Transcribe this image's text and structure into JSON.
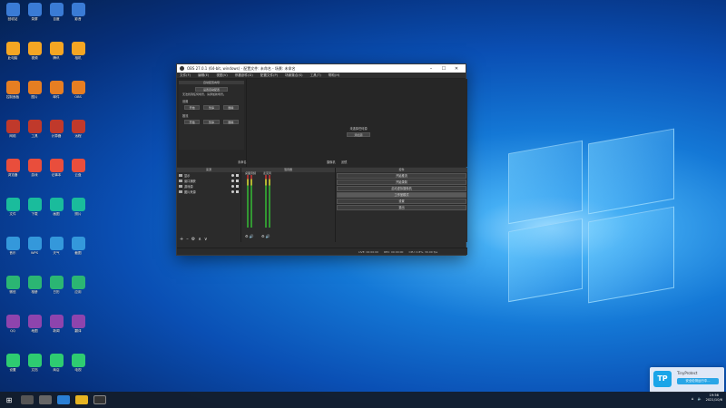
{
  "obs": {
    "title": "OBS 27.0.1 (64-bit, windows) - 配置文件: 未命名 - 场景: 未命名",
    "menu": [
      "文件(F)",
      "编辑(E)",
      "视图(V)",
      "停靠部件(D)",
      "配置文件(P)",
      "场景集合(S)",
      "工具(T)",
      "帮助(H)"
    ],
    "window_controls": [
      "–",
      "☐",
      "✕"
    ],
    "auto_config": {
      "header": "自动配置向导",
      "main_button": "设置自动配置",
      "text": "无法找到任何场景，请添加新场景。",
      "section1": "设置",
      "section1_buttons": [
        "开始",
        "暂停",
        "删除"
      ],
      "section2": "推流",
      "section2_buttons": [
        "开始",
        "暂停",
        "删除"
      ]
    },
    "preview_message": "未选择任何源",
    "preview_button": "添加源",
    "scene_label": "未命名",
    "studio_mode_label": "摄像机",
    "studio_mode_label2": "滤镜",
    "docks": {
      "scenes_header": "来源",
      "mixer_header": "混音器",
      "controls_header": "控件"
    },
    "sources": [
      "显示",
      "窗口捕获",
      "游戏源",
      "图片来源"
    ],
    "mixer": {
      "channel1": "桌面音频",
      "channel2": "麦克风"
    },
    "controls": [
      "开始推流",
      "开始录制",
      "启动虚拟摄像机",
      "工作室模式",
      "设置",
      "退出"
    ],
    "dock_foot": [
      "+",
      "–",
      "⚙",
      "∧",
      "∨"
    ],
    "status": {
      "live": "LIVE: 00:00:00",
      "rec": "REC: 00:00:00",
      "cpu": "CPU: 0.8%, 30.00 fps"
    }
  },
  "desktop": {
    "icons": [
      "回收站",
      "此电脑",
      "控制面板",
      "网络",
      "浏览器",
      "文件",
      "音乐",
      "微信",
      "QQ",
      "设置",
      "录屏",
      "视频",
      "图片",
      "工具",
      "游戏",
      "下载",
      "WPS",
      "相册",
      "地图",
      "文档",
      "百度",
      "腾讯",
      "邮件",
      "计算器",
      "记事本",
      "画图",
      "天气",
      "日历",
      "新闻",
      "商店",
      "影音",
      "相机",
      "OBS",
      "远程",
      "云盘",
      "照片",
      "截图",
      "应用",
      "翻译",
      "电视"
    ]
  },
  "toast": {
    "app": "TinyProtect",
    "button": "安全检测运行中..."
  },
  "clock": {
    "time": "19:56",
    "date": "2021/10/6"
  },
  "colors": {
    "obs_bg": "#2b2b2b",
    "toast_accent": "#29a6e7"
  }
}
